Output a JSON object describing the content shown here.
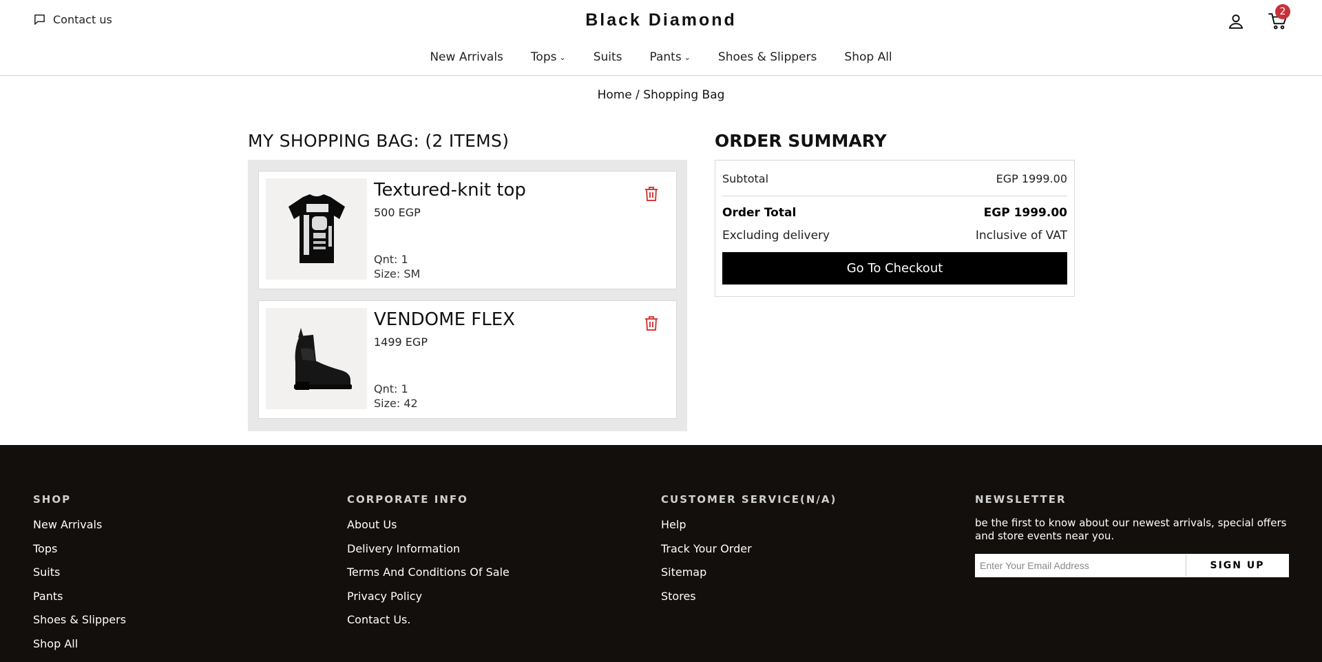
{
  "header": {
    "contact_label": "Contact us",
    "brand": "Black Diamond",
    "cart_count": "2"
  },
  "nav": {
    "items": [
      {
        "label": "New Arrivals"
      },
      {
        "label": "Tops"
      },
      {
        "label": "Suits"
      },
      {
        "label": "Pants"
      },
      {
        "label": "Shoes & Slippers"
      },
      {
        "label": "Shop All"
      }
    ]
  },
  "breadcrumb": "Home / Shopping Bag",
  "bag": {
    "title": "MY SHOPPING BAG: (2 ITEMS)",
    "items": [
      {
        "name": "Textured-knit top",
        "price": "500 EGP",
        "qty": "Qnt: 1",
        "size": "Size: SM",
        "image": "black-tshirt"
      },
      {
        "name": "VENDOME FLEX",
        "price": "1499 EGP",
        "qty": "Qnt: 1",
        "size": "Size: 42",
        "image": "black-chelsea-boot"
      }
    ]
  },
  "summary": {
    "title": "ORDER SUMMARY",
    "subtotal_label": "Subtotal",
    "subtotal_value": "EGP 1999.00",
    "total_label": "Order Total",
    "total_value": "EGP 1999.00",
    "delivery_label": "Excluding delivery",
    "vat_label": "Inclusive of VAT",
    "checkout_label": "Go To Checkout"
  },
  "footer": {
    "shop": {
      "heading": "SHOP",
      "links": [
        "New Arrivals",
        "Tops",
        "Suits",
        "Pants",
        "Shoes & Slippers",
        "Shop All"
      ]
    },
    "corporate": {
      "heading": "CORPORATE INFO",
      "links": [
        "About Us",
        "Delivery Information",
        "Terms And Conditions Of Sale",
        "Privacy Policy",
        "Contact Us."
      ]
    },
    "service": {
      "heading": "CUSTOMER SERVICE(N/A)",
      "links": [
        "Help",
        "Track Your Order",
        "Sitemap",
        "Stores"
      ]
    },
    "newsletter": {
      "heading": "NEWSLETTER",
      "text": "be the first to know about our newest arrivals, special offers and store events near you.",
      "placeholder": "Enter Your Email Address",
      "button": "SIGN UP"
    }
  },
  "colors": {
    "accent_red": "#c8313a",
    "footer_bg": "#130f0c"
  }
}
